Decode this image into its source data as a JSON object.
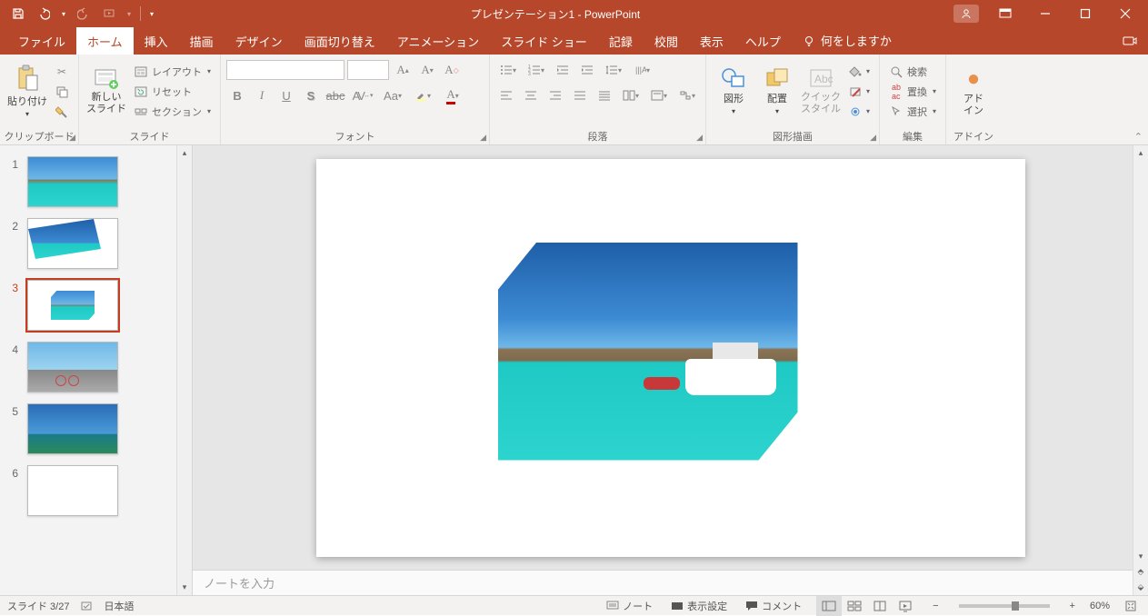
{
  "title": "プレゼンテーション1  -  PowerPoint",
  "tabs": {
    "file": "ファイル",
    "home": "ホーム",
    "insert": "挿入",
    "draw": "描画",
    "design": "デザイン",
    "transitions": "画面切り替え",
    "animations": "アニメーション",
    "slideshow": "スライド ショー",
    "record": "記録",
    "review": "校閲",
    "view": "表示",
    "help": "ヘルプ",
    "tellme": "何をしますか"
  },
  "ribbon": {
    "clipboard": {
      "paste": "貼り付け",
      "label": "クリップボード"
    },
    "slides": {
      "new": "新しい\nスライド",
      "layout": "レイアウト",
      "reset": "リセット",
      "section": "セクション",
      "label": "スライド"
    },
    "font": {
      "label": "フォント"
    },
    "paragraph": {
      "label": "段落"
    },
    "drawing": {
      "shapes": "図形",
      "arrange": "配置",
      "quick": "クイック\nスタイル",
      "label": "図形描画"
    },
    "editing": {
      "find": "検索",
      "replace": "置換",
      "select": "選択",
      "label": "編集"
    },
    "addins": {
      "btn": "アド\nイン",
      "label": "アドイン"
    }
  },
  "thumbnails": {
    "items": [
      {
        "n": "1"
      },
      {
        "n": "2"
      },
      {
        "n": "3"
      },
      {
        "n": "4"
      },
      {
        "n": "5"
      },
      {
        "n": "6"
      }
    ]
  },
  "notes": {
    "placeholder": "ノートを入力"
  },
  "status": {
    "slide": "スライド 3/27",
    "lang": "日本語",
    "notes": "ノート",
    "display": "表示設定",
    "comments": "コメント",
    "zoom": "60%"
  }
}
